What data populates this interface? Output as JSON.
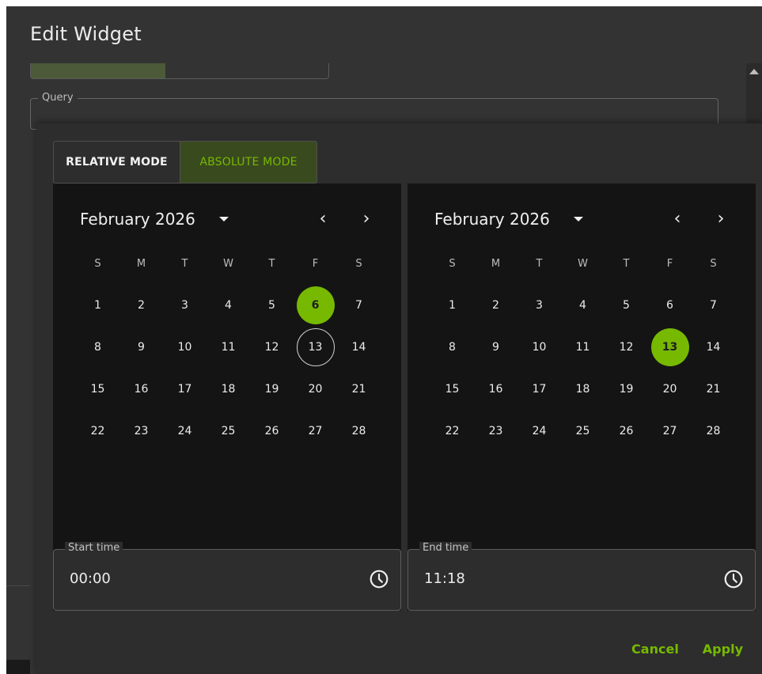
{
  "dialog": {
    "title": "Edit Widget"
  },
  "query": {
    "label": "Query"
  },
  "mode_toggle": {
    "relative_label": "RELATIVE MODE",
    "absolute_label": "ABSOLUTE MODE",
    "active": "absolute"
  },
  "weekday_headers": [
    "S",
    "M",
    "T",
    "W",
    "T",
    "F",
    "S"
  ],
  "start_calendar": {
    "month": "February 2026",
    "selected_day": 6,
    "today_day": 13,
    "weeks": [
      [
        "1",
        "2",
        "3",
        "4",
        "5",
        "6",
        "7"
      ],
      [
        "8",
        "9",
        "10",
        "11",
        "12",
        "13",
        "14"
      ],
      [
        "15",
        "16",
        "17",
        "18",
        "19",
        "20",
        "21"
      ],
      [
        "22",
        "23",
        "24",
        "25",
        "26",
        "27",
        "28"
      ]
    ]
  },
  "end_calendar": {
    "month": "February 2026",
    "selected_day": 13,
    "weeks": [
      [
        "1",
        "2",
        "3",
        "4",
        "5",
        "6",
        "7"
      ],
      [
        "8",
        "9",
        "10",
        "11",
        "12",
        "13",
        "14"
      ],
      [
        "15",
        "16",
        "17",
        "18",
        "19",
        "20",
        "21"
      ],
      [
        "22",
        "23",
        "24",
        "25",
        "26",
        "27",
        "28"
      ]
    ]
  },
  "start_time": {
    "label": "Start time",
    "value": "00:00"
  },
  "end_time": {
    "label": "End time",
    "value": "11:18"
  },
  "actions": {
    "cancel_label": "Cancel",
    "apply_label": "Apply"
  },
  "colors": {
    "accent": "#76b900",
    "dialog_bg": "#333333",
    "calendar_bg": "#141414",
    "popover_bg": "#2d2d2d"
  },
  "icons": [
    "chevron-left-icon",
    "chevron-right-icon",
    "caret-down-icon",
    "clock-icon",
    "scroll-up-arrow-icon"
  ]
}
